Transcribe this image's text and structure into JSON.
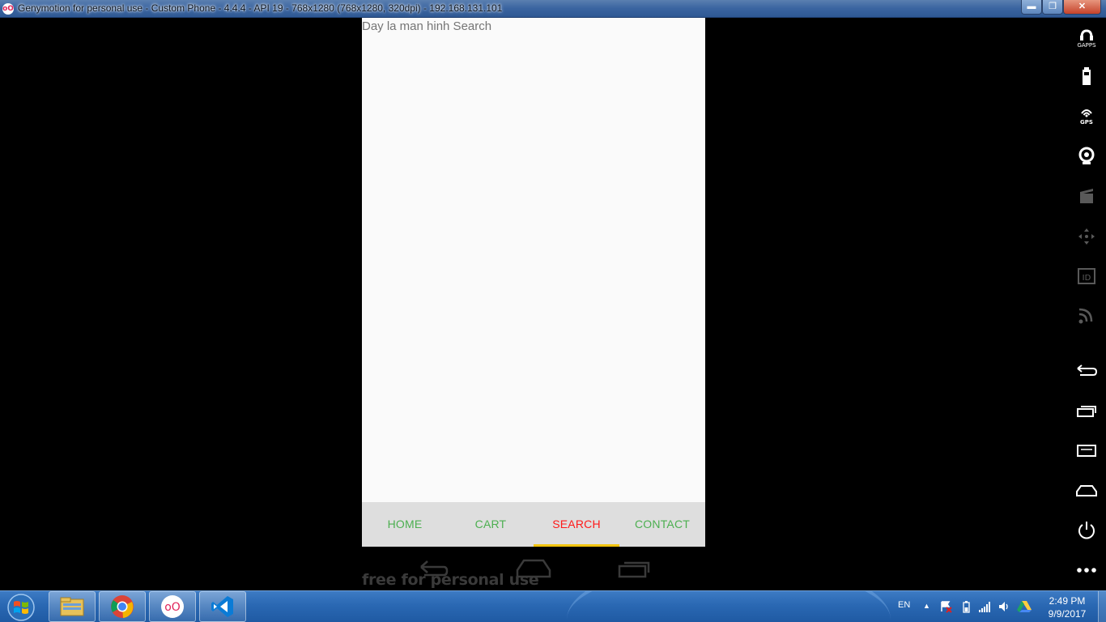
{
  "window": {
    "app_icon_text": "oO",
    "title": "Genymotion for personal use - Custom Phone - 4.4.4 - API 19 - 768x1280 (768x1280, 320dpi) - 192.168.131.101"
  },
  "phone": {
    "screen_text": "Day la man hinh Search",
    "tabs": [
      {
        "label": "HOME",
        "active": false
      },
      {
        "label": "CART",
        "active": false
      },
      {
        "label": "SEARCH",
        "active": true
      },
      {
        "label": "CONTACT",
        "active": false
      }
    ],
    "watermark": "free for personal use"
  },
  "sidebar": {
    "gapps_label": "GAPPS",
    "gps_label": "GPS",
    "id_label": "ID"
  },
  "taskbar": {
    "language": "EN",
    "time": "2:49 PM",
    "date": "9/9/2017",
    "genymotion_icon_text": "oO"
  },
  "colors": {
    "tab_inactive": "#4caf50",
    "tab_active": "#ff1a1a",
    "tab_indicator": "#f2c40e",
    "nav_background": "#dedede"
  }
}
